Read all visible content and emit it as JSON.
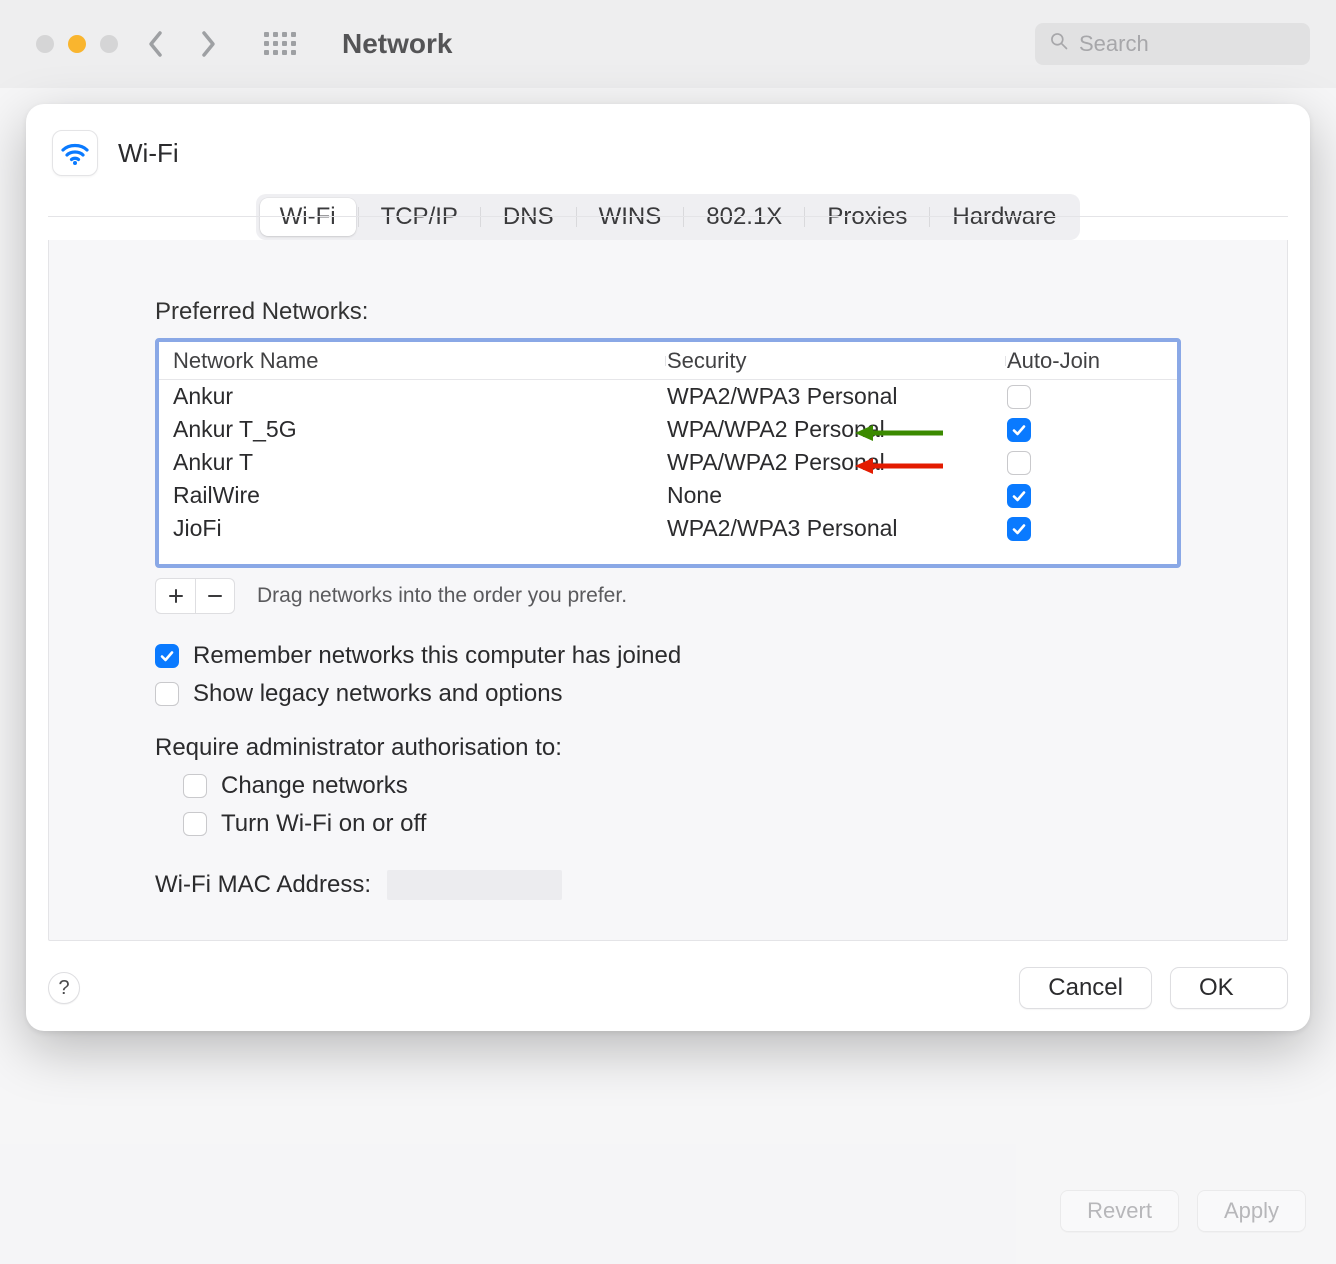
{
  "window": {
    "title": "Network",
    "search_placeholder": "Search"
  },
  "sheet": {
    "title": "Wi-Fi",
    "tabs": [
      "Wi-Fi",
      "TCP/IP",
      "DNS",
      "WINS",
      "802.1X",
      "Proxies",
      "Hardware"
    ],
    "active_tab": 0,
    "preferred_label": "Preferred Networks:",
    "columns": {
      "name": "Network Name",
      "security": "Security",
      "autojoin": "Auto-Join"
    },
    "networks": [
      {
        "name": "Ankur",
        "security": "WPA2/WPA3 Personal",
        "autojoin": false
      },
      {
        "name": "Ankur T_5G",
        "security": "WPA/WPA2 Personal",
        "autojoin": true
      },
      {
        "name": "Ankur T",
        "security": "WPA/WPA2 Personal",
        "autojoin": false
      },
      {
        "name": "RailWire",
        "security": "None",
        "autojoin": true
      },
      {
        "name": "JioFi",
        "security": "WPA2/WPA3 Personal",
        "autojoin": true
      }
    ],
    "arrows": {
      "green_row": 1,
      "red_row": 2
    },
    "drag_hint": "Drag networks into the order you prefer.",
    "remember_label": "Remember networks this computer has joined",
    "remember_checked": true,
    "legacy_label": "Show legacy networks and options",
    "legacy_checked": false,
    "admin_label": "Require administrator authorisation to:",
    "admin_change_label": "Change networks",
    "admin_change_checked": false,
    "admin_wifi_label": "Turn Wi-Fi on or off",
    "admin_wifi_checked": false,
    "mac_label": "Wi-Fi MAC Address:",
    "mac_value": "",
    "help_label": "?",
    "cancel_label": "Cancel",
    "ok_label": "OK"
  },
  "bottom": {
    "revert": "Revert",
    "apply": "Apply"
  }
}
